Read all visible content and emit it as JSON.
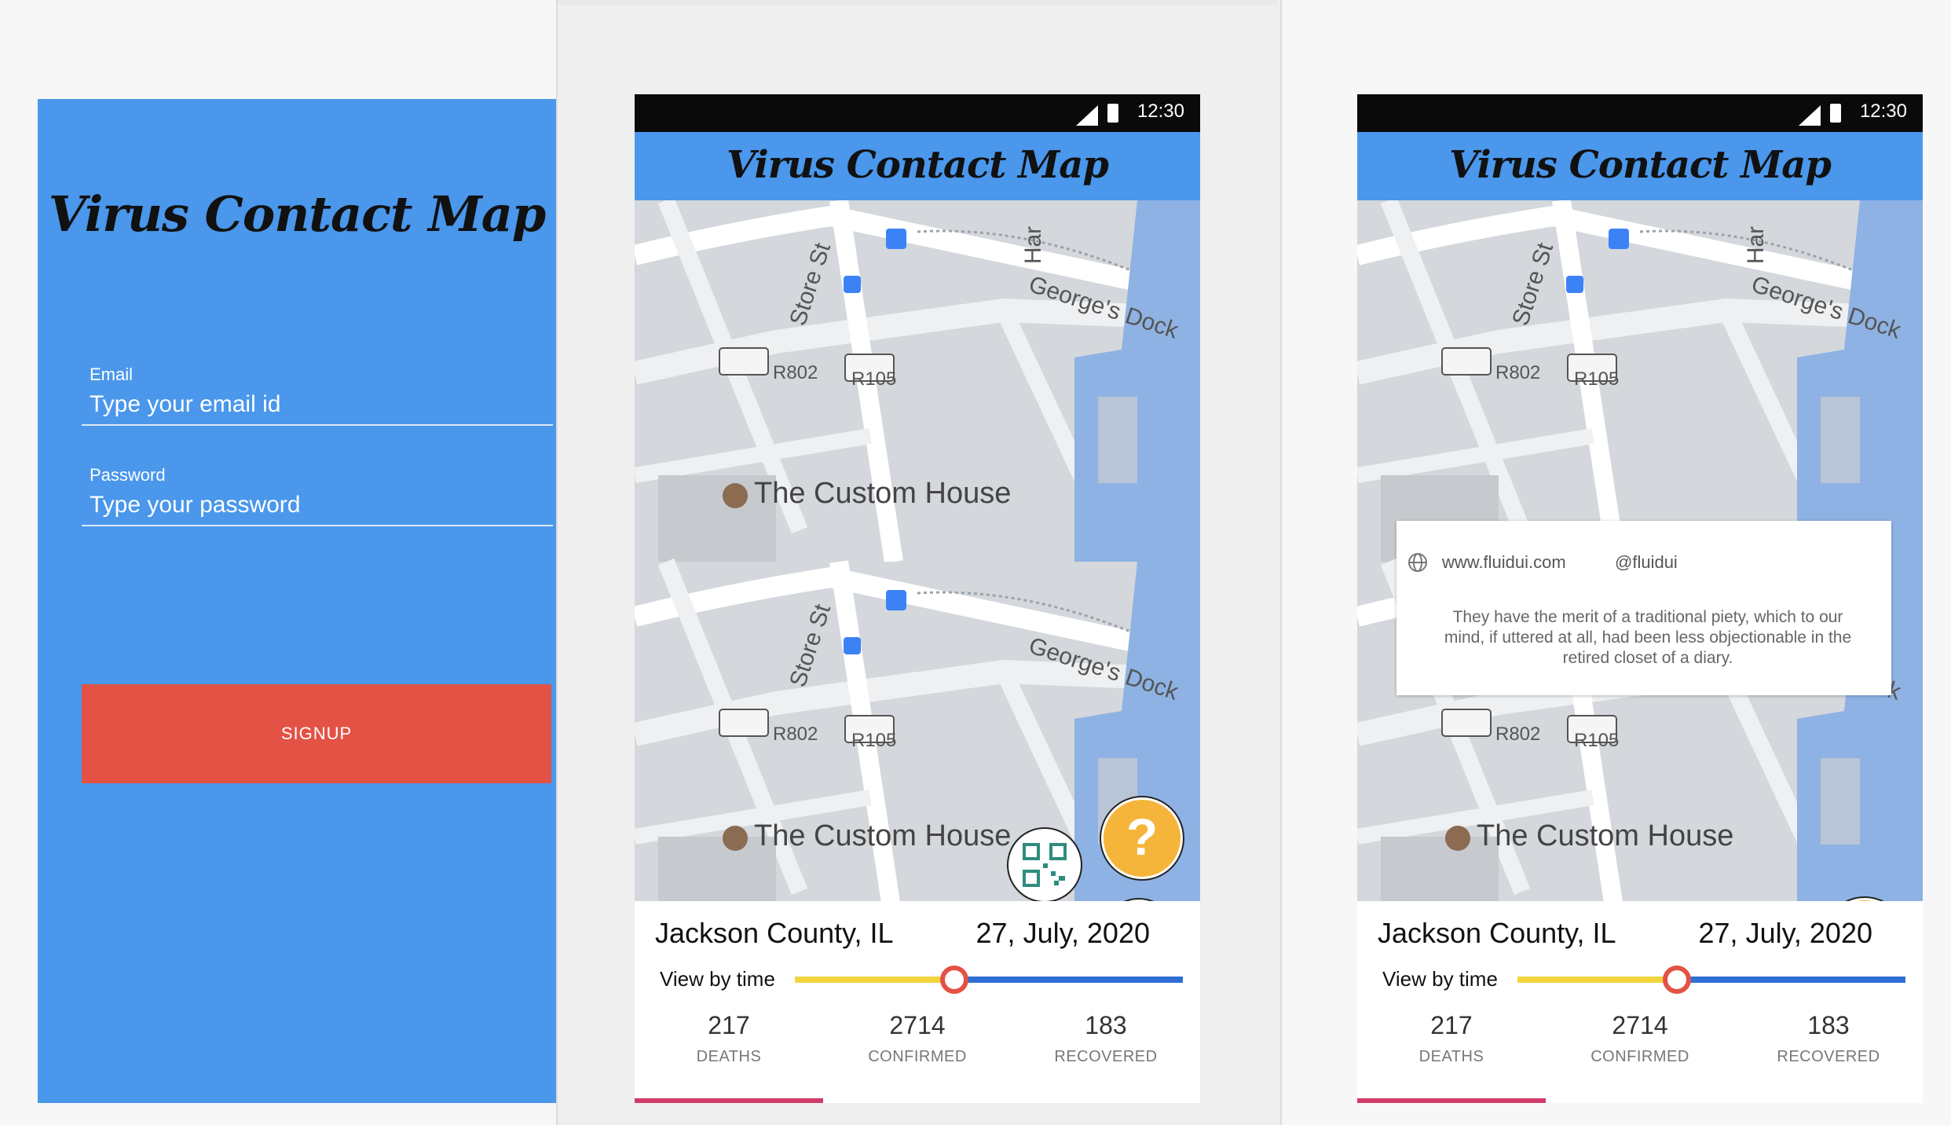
{
  "app_title": "Virus Contact Map",
  "login": {
    "email_label": "Email",
    "email_placeholder": "Type your email id",
    "password_label": "Password",
    "password_placeholder": "Type your password",
    "signup_label": "SIGNUP",
    "button_color": "#e35244",
    "background_color": "#4a97eb"
  },
  "status_bar": {
    "time": "12:30"
  },
  "map": {
    "labels": {
      "custom_house": "The Custom House",
      "store_st": "Store St",
      "georges_dock": "George's Dock",
      "r802": "R802",
      "r105": "R105",
      "har": "Har"
    }
  },
  "info": {
    "location": "Jackson County, IL",
    "date": "27, July, 2020",
    "view_by_time": "View by time",
    "slider_position": 0.41,
    "stats": [
      {
        "value": "217",
        "label": "DEATHS"
      },
      {
        "value": "2714",
        "label": "CONFIRMED"
      },
      {
        "value": "183",
        "label": "RECOVERED"
      }
    ]
  },
  "popup": {
    "website": "www.fluidui.com",
    "handle": "@fluidui",
    "text": "They have the merit of a traditional piety, which to our mind, if uttered at all, had been less objectionable in the retired closet of a diary."
  },
  "fabs": {
    "help": "?"
  },
  "colors": {
    "primary": "#4a97eb",
    "accent": "#e35244",
    "slider_past": "#f2d43f",
    "slider_future": "#2f6fd5",
    "tab_indicator": "#d03c6a",
    "help_fab": "#f5b53b"
  }
}
